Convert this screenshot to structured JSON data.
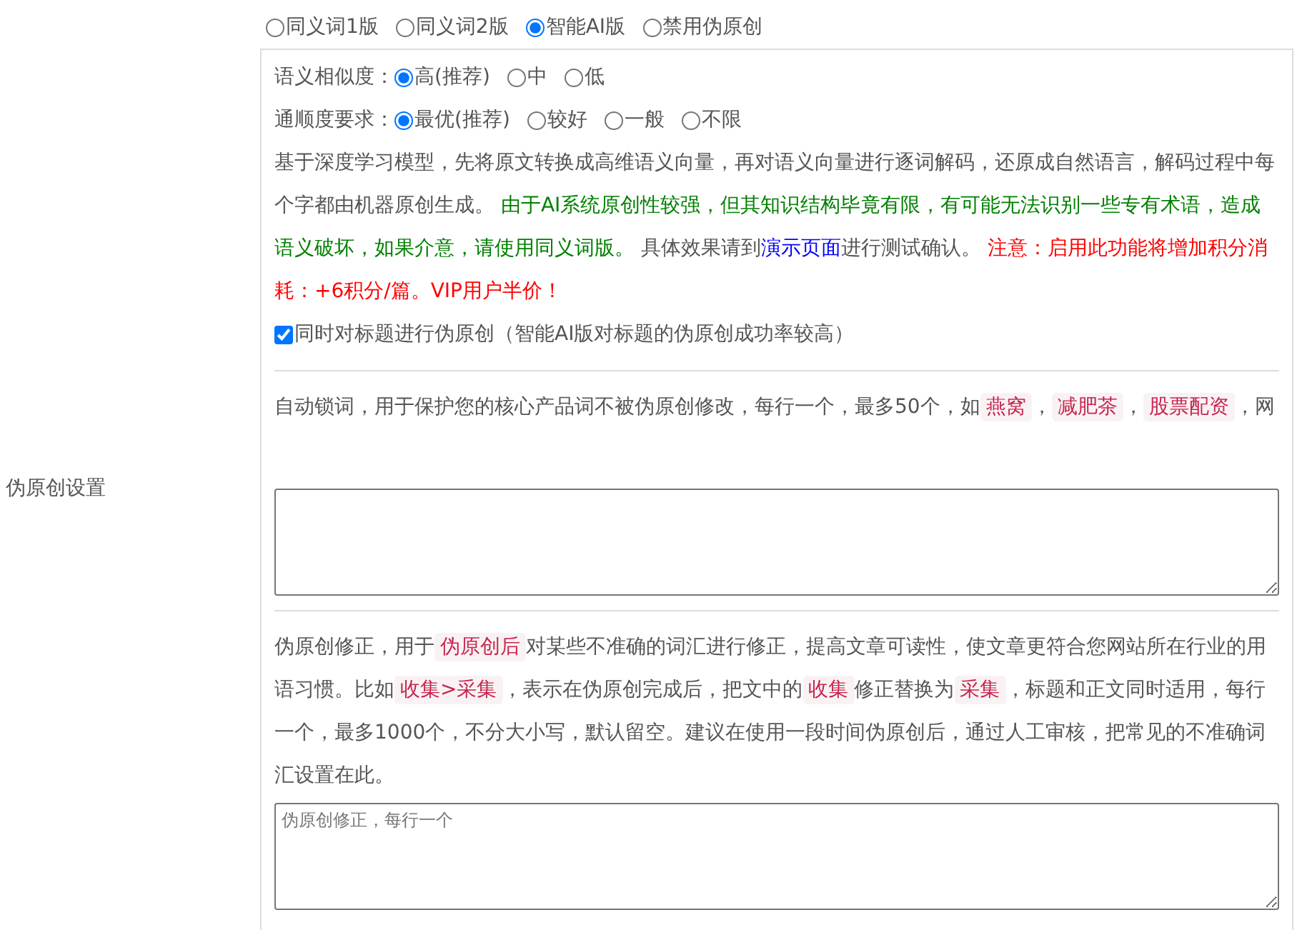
{
  "mode_options": [
    {
      "label": "同义词1版",
      "selected": false
    },
    {
      "label": "同义词2版",
      "selected": false
    },
    {
      "label": "智能AI版",
      "selected": true
    },
    {
      "label": "禁用伪原创",
      "selected": false
    }
  ],
  "side_label": "伪原创设置",
  "similarity": {
    "label": "语义相似度：",
    "options": [
      {
        "label": "高(推荐)",
        "selected": true
      },
      {
        "label": "中",
        "selected": false
      },
      {
        "label": "低",
        "selected": false
      }
    ]
  },
  "fluency": {
    "label": "通顺度要求：",
    "options": [
      {
        "label": "最优(推荐)",
        "selected": true
      },
      {
        "label": "较好",
        "selected": false
      },
      {
        "label": "一般",
        "selected": false
      },
      {
        "label": "不限",
        "selected": false
      }
    ]
  },
  "description": [
    {
      "kind": "plain",
      "text": "基于深度学习模型，先将原文转换成高维语义向量，再对语义向量进行逐词解码，还原成自然语言，解码过程中每个字都由机器原创生成。 "
    },
    {
      "kind": "green",
      "text": "由于AI系统原创性较强，但其知识结构毕竟有限，有可能无法识别一些专有术语，造成语义破坏，如果介意，请使用同义词版。"
    },
    {
      "kind": "plain",
      "text": " 具体效果请到"
    },
    {
      "kind": "link",
      "text": "演示页面"
    },
    {
      "kind": "plain",
      "text": "进行测试确认。 "
    },
    {
      "kind": "red",
      "text": "注意：启用此功能将增加积分消耗：+6积分/篇。VIP用户半价！"
    }
  ],
  "title_checkbox": {
    "label": "同时对标题进行伪原创（智能AI版对标题的伪原创成功率较高）",
    "checked": true
  },
  "lock_words": [
    {
      "kind": "plain",
      "text": "自动锁词，用于保护您的核心产品词不被伪原创修改，每行一个，最多50个，如"
    },
    {
      "kind": "code",
      "text": "燕窝"
    },
    {
      "kind": "plain",
      "text": "，"
    },
    {
      "kind": "code",
      "text": "减肥茶"
    },
    {
      "kind": "plain",
      "text": "，"
    },
    {
      "kind": "code",
      "text": "股票配资"
    },
    {
      "kind": "plain",
      "text": "，网"
    }
  ],
  "correction": [
    {
      "kind": "plain",
      "text": "伪原创修正，用于"
    },
    {
      "kind": "code",
      "text": "伪原创后"
    },
    {
      "kind": "plain",
      "text": "对某些不准确的词汇进行修正，提高文章可读性，使文章更符合您网站所在行业的用语习惯。比如"
    },
    {
      "kind": "code",
      "text": "收集>采集"
    },
    {
      "kind": "plain",
      "text": "，表示在伪原创完成后，把文中的"
    },
    {
      "kind": "code",
      "text": "收集"
    },
    {
      "kind": "plain",
      "text": "修正替换为"
    },
    {
      "kind": "code",
      "text": "采集"
    },
    {
      "kind": "plain",
      "text": "，标题和正文同时适用，每行一个，最多1000个，不分大小写，默认留空。建议在使用一段时间伪原创后，通过人工审核，把常见的不准确词汇设置在此。"
    }
  ],
  "correction_field": {
    "placeholder": "伪原创修正，每行一个"
  }
}
